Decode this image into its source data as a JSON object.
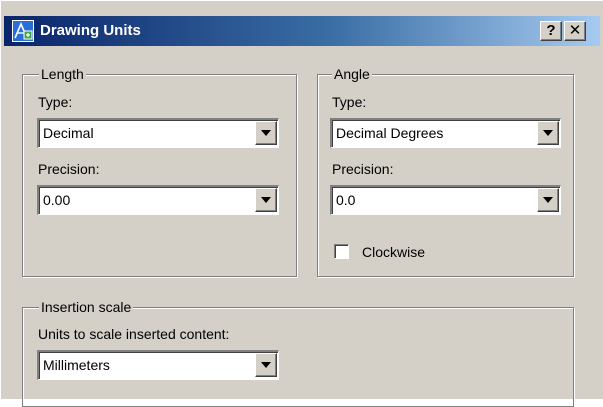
{
  "window": {
    "title": "Drawing Units",
    "icon": "drawing-units-icon",
    "help_button": "?",
    "close_button": "✕"
  },
  "length": {
    "legend": "Length",
    "type_label": "Type:",
    "type_value": "Decimal",
    "precision_label": "Precision:",
    "precision_value": "0.00"
  },
  "angle": {
    "legend": "Angle",
    "type_label": "Type:",
    "type_value": "Decimal Degrees",
    "precision_label": "Precision:",
    "precision_value": "0.0",
    "clockwise_label": "Clockwise",
    "clockwise_checked": false
  },
  "insertion": {
    "legend": "Insertion scale",
    "units_label": "Units to scale inserted content:",
    "units_value": "Millimeters"
  },
  "colors": {
    "titlebar_start": "#0a246a",
    "titlebar_end": "#a6caf0",
    "dialog_face": "#d4d0c8"
  }
}
